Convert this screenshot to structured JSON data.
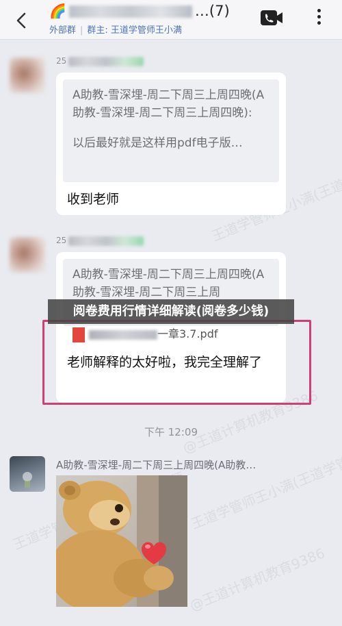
{
  "header": {
    "title_emoji": "🌈",
    "title_suffix": "…(7)",
    "tag": "外部群",
    "group_owner": "群主: 王道学管师王小满"
  },
  "messages": [
    {
      "sender": "25",
      "quote_line1": "A助教-雪深埋-周二下周三上周四晚(A助教-雪深埋-周二下周三上周四晚):",
      "quote_line2": "以后最好就是这样用pdf电子版…",
      "reply": "收到老师"
    },
    {
      "sender": "25",
      "quote_line1": "A助教-雪深埋-周二下周三上周四晚(A助教-雪深埋-周二下周三上周",
      "pdf_name": "一章3.7.pdf",
      "reply": "老师解释的太好啦，我完全理解了"
    }
  ],
  "overlay_title": "阅卷费用行情详细解读(阅卷多少钱)",
  "time_separator": "下午 12:09",
  "message3": {
    "sender": "A助教-雪深埋-周二下周三上周四晚(A助教…"
  },
  "watermarks": [
    "王道学管师王小满(王道学管师",
    "@王道计算机教育9386",
    "王道学管师王小满(王道学管师",
    "@王道计算机教育9386",
    "王道学管师王小满(王道学管师"
  ],
  "colors": {
    "header_bg": "#f6f6f8",
    "chat_bg": "#e9ebf0",
    "link_blue": "#4a74c4",
    "highlight_border": "#cf3f74"
  }
}
